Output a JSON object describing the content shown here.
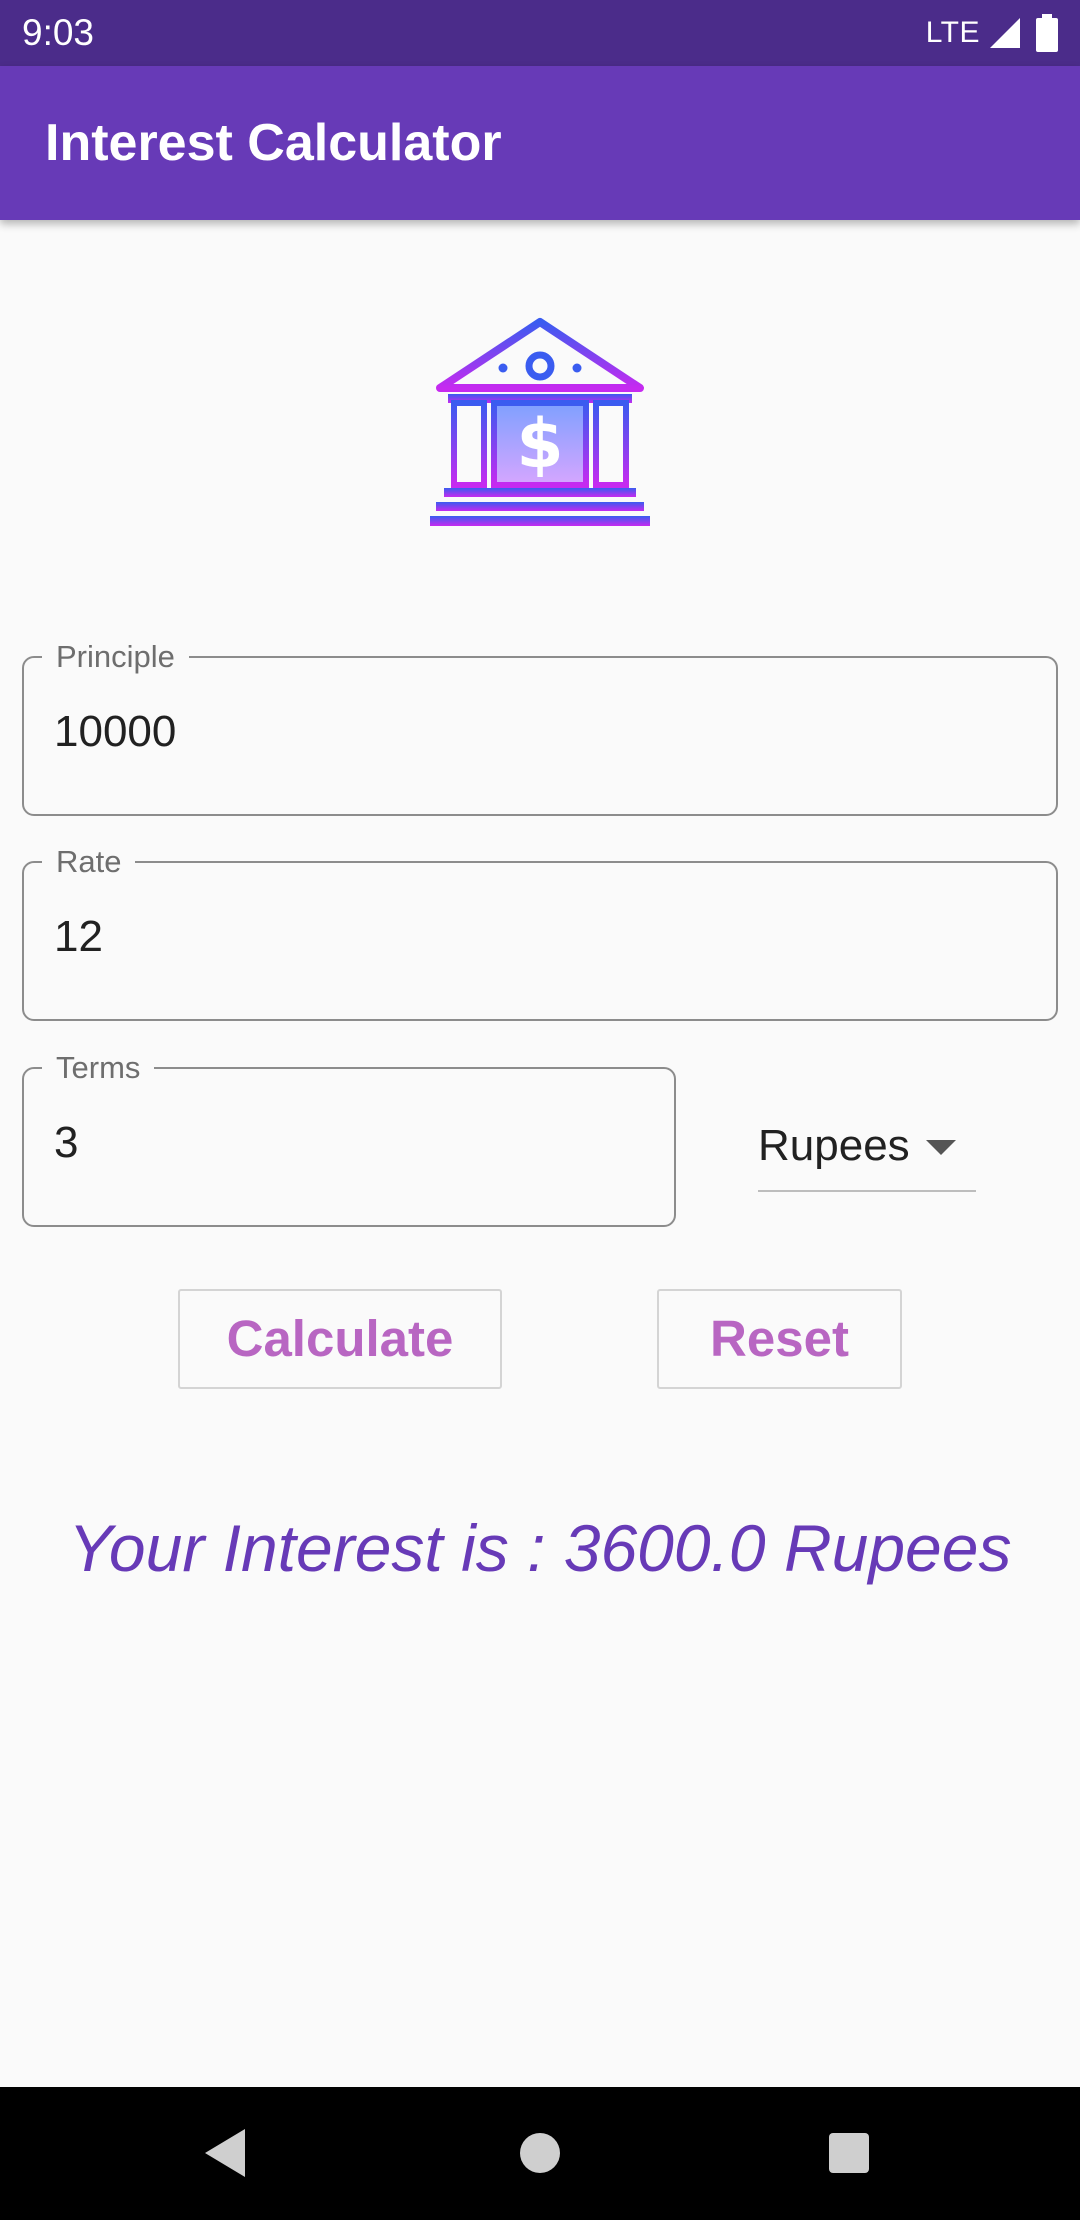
{
  "status_bar": {
    "time": "9:03",
    "network": "LTE",
    "signal_icon": "cell-signal-icon",
    "battery_icon": "battery-icon"
  },
  "app_bar": {
    "title": "Interest Calculator",
    "color": "#673ab7"
  },
  "logo": {
    "icon": "bank-icon"
  },
  "form": {
    "principle": {
      "label": "Principle",
      "value": "10000"
    },
    "rate": {
      "label": "Rate",
      "value": "12"
    },
    "terms": {
      "label": "Terms",
      "value": "3"
    },
    "currency": {
      "selected": "Rupees",
      "icon": "dropdown-arrow-icon"
    }
  },
  "buttons": {
    "calculate": "Calculate",
    "reset": "Reset",
    "color": "#b866c2"
  },
  "result": {
    "text": "Your Interest is : 3600.0 Rupees"
  },
  "nav": {
    "back_icon": "back-icon",
    "home_icon": "home-icon",
    "recents_icon": "recents-icon"
  }
}
